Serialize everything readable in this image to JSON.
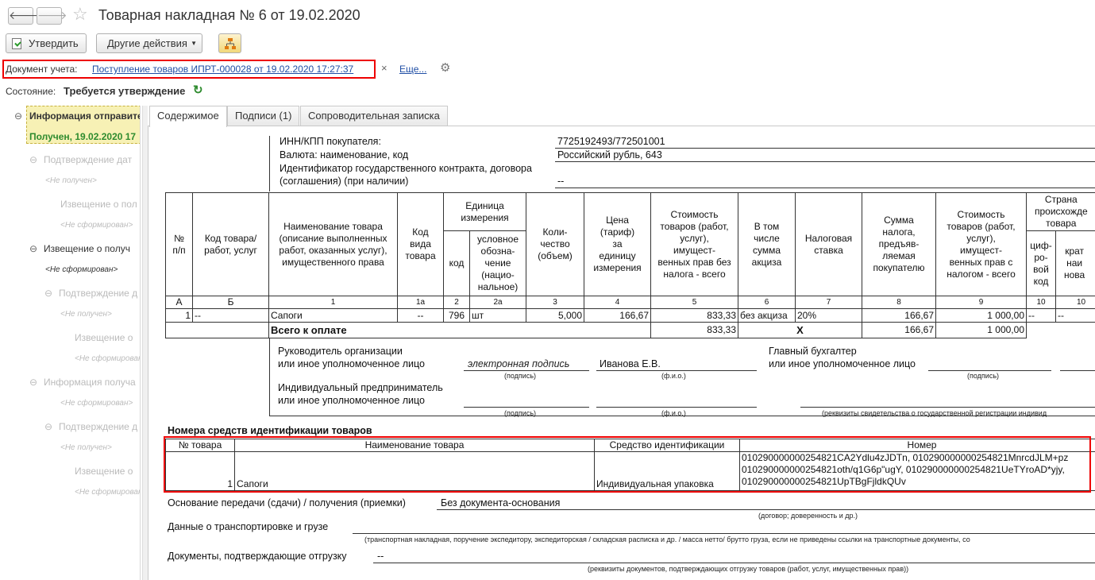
{
  "window": {
    "title": "Товарная накладная № 6 от 19.02.2020"
  },
  "toolbar": {
    "approve": "Утвердить",
    "other_actions": "Другие действия"
  },
  "doc_account": {
    "label": "Документ учета:",
    "link": "Поступление товаров ИПРТ-000028 от 19.02.2020 17:27:37",
    "close": "×",
    "more": "Еще..."
  },
  "state": {
    "label": "Состояние:",
    "value": "Требуется утверждение"
  },
  "tree": [
    "Информация отправите",
    "Получен, 19.02.2020 17",
    "Подтверждение дат",
    "<Не получен>",
    "Извещение о пол",
    "<Не сформирован>",
    "Извещение о получ",
    "<Не сформирован>",
    "Подтверждение д",
    "<Не получен>",
    "Извещение о",
    "<Не сформирован>",
    "Информация получа",
    "<Не сформирован>",
    "Подтверждение д",
    "<Не получен>",
    "Извещение о",
    "<Не сформирован>"
  ],
  "tabs": [
    "Содержимое",
    "Подписи (1)",
    "Сопроводительная записка"
  ],
  "buyer": {
    "inn_label": "ИНН/КПП покупателя:",
    "inn_value": "7725192493/772501001",
    "currency_label": "Валюта: наименование, код",
    "currency_value": "Российский рубль, 643",
    "contract_label1": "Идентификатор государственного контракта, договора",
    "contract_label2": "(соглашения) (при наличии)",
    "contract_value": "--"
  },
  "table": {
    "h_num": "№\nп/п",
    "h_code": "Код товара/\nработ, услуг",
    "h_name": "Наименование товара\n(описание выполненных\nработ, оказанных услуг),\nимущественного права",
    "h_kind": "Код\nвида\nтовара",
    "h_unit": "Единица\nизмерения",
    "h_unit_code": "код",
    "h_unit_name": "условное\nобозна-\nчение\n(нацио-\nнальное)",
    "h_qty": "Коли-\nчество\n(объем)",
    "h_price": "Цена\n(тариф)\nза\nединицу\nизмерения",
    "h_cost": "Стоимость\nтоваров (работ,\nуслуг),\nимущест-\nвенных прав без\nналога - всего",
    "h_excise": "В том\nчисле\nсумма\nакциза",
    "h_rate": "Налоговая\nставка",
    "h_tax": "Сумма\nналога,\nпредъяв-\nляемая\nпокупателю",
    "h_total": "Стоимость\nтоваров (работ,\nуслуг),\nимущест-\nвенных прав с\nналогом - всего",
    "h_country": "Страна\nпроисхожде\nтовара",
    "h_country_code": "циф-\nро-\nвой\nкод",
    "h_country_short": "крат\nнаи\nнова",
    "nums": [
      "А",
      "Б",
      "1",
      "1а",
      "2",
      "2а",
      "3",
      "4",
      "5",
      "6",
      "7",
      "8",
      "9",
      "10",
      "10"
    ],
    "row": [
      "1",
      "--",
      "Сапоги",
      "--",
      "796",
      "шт",
      "5,000",
      "166,67",
      "833,33",
      "без акциза",
      "20%",
      "166,67",
      "1 000,00",
      "--",
      "--"
    ],
    "total_label": "Всего к оплате",
    "total_cost": "833,33",
    "total_x": "X",
    "total_tax": "166,67",
    "total_sum": "1 000,00"
  },
  "signatures": {
    "head_label1": "Руководитель организации",
    "head_label2": "или иное уполномоченное лицо",
    "e_sign": "электронная подпись",
    "head_name": "Иванова Е.В.",
    "sign_caption": "(подпись)",
    "fio_caption": "(ф.и.о.)",
    "accountant1": "Главный бухгалтер",
    "accountant2": "или иное уполномоченное лицо",
    "ip1": "Индивидуальный предприниматель",
    "ip2": "или иное уполномоченное лицо",
    "reg_caption": "(реквизиты свидетельства о государственной  регистрации индивид"
  },
  "ident": {
    "title": "Номера средств идентификации товаров",
    "h_num": "№ товара",
    "h_name": "Наименование товара",
    "h_means": "Средство идентификации",
    "h_number": "Номер",
    "num": "1",
    "name": "Сапоги",
    "means": "Индивидуальная упаковка",
    "codes": [
      "010290000000254821CA2Ydlu4zJDTn, 010290000000254821MnrcdJLM+pz",
      "010290000000254821oth/q1G6p\"ugY, 010290000000254821UeTYroAD*yjy,",
      "010290000000254821UpTBgFjldkQUv"
    ]
  },
  "footer": {
    "basis_label": "Основание передачи (сдачи) / получения (приемки)",
    "basis_value": "Без документа-основания",
    "basis_caption": "(договор; доверенность и др.)",
    "transport_label": "Данные о транспортировке и грузе",
    "transport_caption": "(транспортная накладная, поручение экспедитору, экспедиторская / складская расписка и др. / масса нетто/ брутто груза, если не приведены ссылки на транспортные документы, со",
    "docs_label": "Документы, подтверждающие отгрузку",
    "docs_value": "--",
    "docs_caption": "(реквизиты документов, подтверждающих отгрузку товаров (работ, услуг, имущественных прав))"
  },
  "colors": {
    "link": "#1f4ea5",
    "highlight": "#e00000",
    "selected_bg": "#f7f1b5",
    "status_green": "#2e8b2e"
  }
}
